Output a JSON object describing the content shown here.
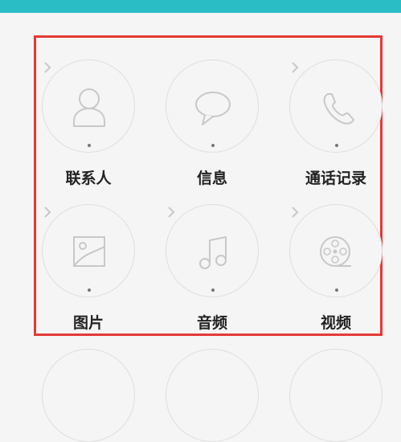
{
  "header": {
    "bar_color": "#2bbdc5"
  },
  "highlight": {
    "color": "#e53935"
  },
  "tiles": [
    {
      "label": "联系人",
      "icon": "contact-icon"
    },
    {
      "label": "信息",
      "icon": "message-icon"
    },
    {
      "label": "通话记录",
      "icon": "phone-icon"
    },
    {
      "label": "图片",
      "icon": "image-icon"
    },
    {
      "label": "音频",
      "icon": "music-icon"
    },
    {
      "label": "视频",
      "icon": "video-reel-icon"
    }
  ]
}
